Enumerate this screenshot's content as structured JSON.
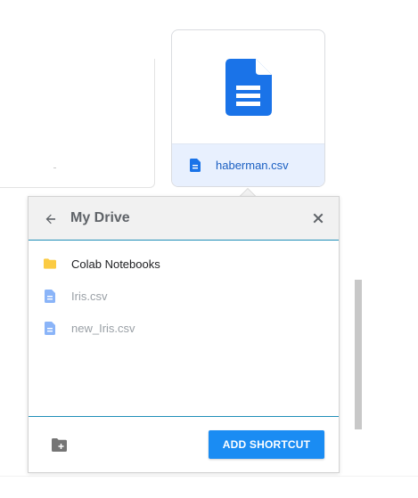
{
  "file_card": {
    "name": "haberman.csv",
    "icon": "document-icon",
    "accent": "#1a73e8"
  },
  "dialog": {
    "title": "My Drive",
    "items": [
      {
        "label": "Colab Notebooks",
        "icon": "folder-icon",
        "enabled": true
      },
      {
        "label": "Iris.csv",
        "icon": "document-icon",
        "enabled": false
      },
      {
        "label": "new_Iris.csv",
        "icon": "document-icon",
        "enabled": false
      }
    ],
    "add_button_label": "ADD SHORTCUT",
    "colors": {
      "header_bg": "#f1f1f1",
      "divider": "#1f8fb8",
      "primary_button": "#1a8cf3",
      "folder": "#fbcb43",
      "disabled_doc": "#8ab4f8"
    }
  }
}
